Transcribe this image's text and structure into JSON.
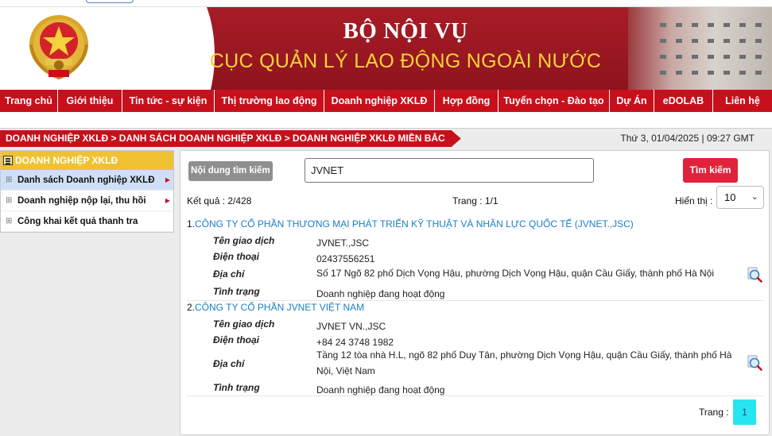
{
  "header": {
    "title": "BỘ NỘI VỤ",
    "subtitle": "CỤC QUẢN LÝ LAO ĐỘNG NGOÀI NƯỚC"
  },
  "nav": [
    {
      "label": "Trang chủ"
    },
    {
      "label": "Giới thiệu"
    },
    {
      "label": "Tin tức - sự kiện"
    },
    {
      "label": "Thị trường lao động"
    },
    {
      "label": "Doanh nghiệp XKLĐ"
    },
    {
      "label": "Hợp đồng"
    },
    {
      "label": "Tuyển chọn - Đào tạo"
    },
    {
      "label": "Dự Án"
    },
    {
      "label": "eDOLAB"
    },
    {
      "label": "Liên hệ"
    }
  ],
  "breadcrumb": "DOANH NGHIỆP XKLĐ > DANH SÁCH DOANH NGHIỆP XKLĐ > DOANH NGHIỆP XKLĐ MIỀN BẮC",
  "datetime": "Thứ 3, 01/04/2025 | 09:27 GMT",
  "sidebar": {
    "heading": "DOANH NGHIỆP XKLĐ",
    "items": [
      {
        "label": "Danh sách Doanh nghiệp XKLĐ"
      },
      {
        "label": "Doanh nghiệp nộp lại, thu hồi"
      },
      {
        "label": "Công khai kết quả thanh tra"
      }
    ]
  },
  "search": {
    "label": "Nội dung tìm kiếm",
    "value": "JVNET",
    "button": "Tìm kiếm"
  },
  "results": {
    "count_text": "Kết quả : 2/428",
    "page_text": "Trang : 1/1",
    "show_label": "Hiển thị :",
    "show_value": "10"
  },
  "field_labels": {
    "trade_name": "Tên giao dịch",
    "phone": "Điện thoại",
    "address": "Địa chỉ",
    "status": "Tình trạng"
  },
  "companies": [
    {
      "num": "1.",
      "name": "CÔNG TY CỔ PHẦN THƯƠNG MẠI PHÁT TRIỂN KỸ THUẬT VÀ NHÂN LỰC QUỐC TẾ (JVNET.,JSC)",
      "trade_name": "JVNET.,JSC",
      "phone": "02437556251",
      "address": "Số 17 Ngõ 82 phố Dịch Vọng Hậu, phường Dịch Vọng Hậu, quận Cầu Giấy, thành phố Hà Nội",
      "status": "Doanh nghiệp đang hoạt động"
    },
    {
      "num": "2.",
      "name": "CÔNG TY CỔ PHẦN JVNET VIỆT NAM",
      "trade_name": "JVNET VN.,JSC",
      "phone": "+84 24 3748 1982",
      "address": "Tầng 12 tòa nhà H.L, ngõ 82 phố Duy Tân, phường Dịch Vọng Hậu, quận Cầu Giấy, thành phố Hà Nội, Việt Nam",
      "status": "Doanh nghiệp đang hoạt động"
    }
  ],
  "pager": {
    "label": "Trang :",
    "current": "1"
  },
  "colors": {
    "brand_red": "#c7101c",
    "header_red": "#a01a24",
    "title_yellow": "#f7d23c",
    "sidebar_yellow": "#f0c232",
    "link_blue": "#1a7fc4",
    "pager_cyan": "#27e6f0"
  }
}
